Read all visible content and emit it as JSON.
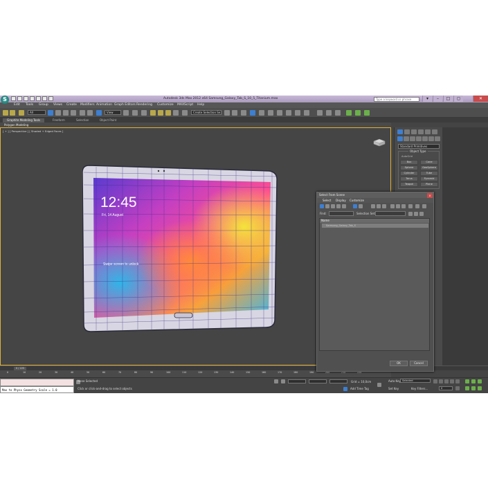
{
  "window": {
    "title": "Autodesk 3ds Max 2012 x64      Samsung_Galaxy_Tab_S_10_5_Titanium.max",
    "search_placeholder": "Type a keyword or phrase",
    "app_logo": "3ds Max logo",
    "buttons": {
      "minimize": "–",
      "maximize": "□",
      "close": "✕"
    }
  },
  "menubar": {
    "items": [
      "Edit",
      "Tools",
      "Group",
      "Views",
      "Create",
      "Modifiers",
      "Animation",
      "Graph Editors",
      "Rendering",
      "Customize",
      "MAXScript",
      "Help"
    ]
  },
  "toolbar": {
    "selection_filter": "All",
    "reference_coord": "View",
    "named_selection": "Create Selection Se"
  },
  "ribbon": {
    "tabs": [
      "Graphite Modeling Tools",
      "Freeform",
      "Selection",
      "Object Paint"
    ],
    "active_tab": "Graphite Modeling Tools",
    "subpanel": "Polygon Modeling"
  },
  "viewport": {
    "label": "[ + ] [ Perspective ] [ Shaded + Edged Faces ]",
    "accent": "#e2b23a"
  },
  "tablet_screen": {
    "time": "12:45",
    "date": "Fri, 14 August",
    "unlock_hint": "Swipe screen to unlock"
  },
  "command_panel": {
    "category": "Standard Primitives",
    "group_title": "Object Type",
    "autogrid": "AutoGrid",
    "buttons": [
      "Box",
      "Cone",
      "Sphere",
      "GeoSphere",
      "Cylinder",
      "Tube",
      "Torus",
      "Pyramid",
      "Teapot",
      "Plane"
    ]
  },
  "dialog": {
    "title": "Select From Scene",
    "close": "x",
    "menu": [
      "Select",
      "Display",
      "Customize"
    ],
    "find_label": "Find:",
    "selection_set_label": "Selection Set:",
    "column_header": "Name",
    "rows": [
      "Samsung_Galaxy_Tab_S"
    ],
    "ok": "OK",
    "cancel": "Cancel"
  },
  "timeline": {
    "frame_counter": "0 / 225",
    "ticks": [
      "0",
      "10",
      "20",
      "30",
      "40",
      "50",
      "60",
      "70",
      "80",
      "90",
      "100",
      "110",
      "120",
      "130",
      "140",
      "150",
      "160",
      "170",
      "180",
      "190",
      "200",
      "210",
      "220"
    ]
  },
  "status": {
    "maxscript_output": "Max to Physx Geometry Scale = 1.0",
    "selection": "None Selected",
    "prompt": "Click or click-and-drag to select objects",
    "grid": "Grid = 10,0cm",
    "add_time_tag": "Add Time Tag",
    "auto_key": "Auto Key",
    "set_key": "Set Key",
    "key_mode": "Selected",
    "key_filters": "Key Filters...",
    "frame": "0"
  }
}
